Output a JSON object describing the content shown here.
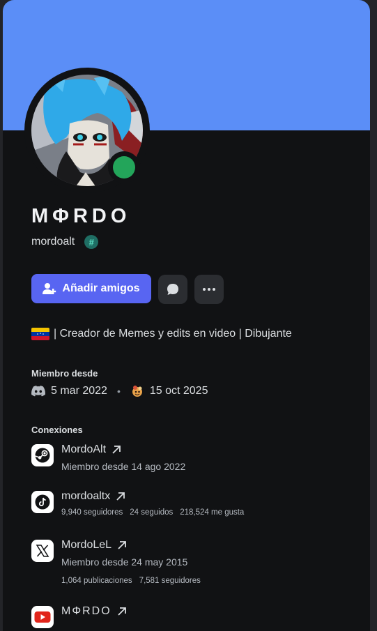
{
  "profile": {
    "display_name": "MΦRDO",
    "username": "mordoalt",
    "tag_symbol": "#",
    "online_status_color": "#23a55a",
    "banner_color": "#5b8ef7"
  },
  "actions": {
    "add_friend_label": "Añadir amigos",
    "message_icon": "chat-bubble-icon",
    "more_icon": "ellipsis-icon"
  },
  "bio": {
    "flag": "venezuela-flag",
    "text": "| Creador de Memes y edits en video | Dibujante"
  },
  "member_since": {
    "title": "Miembro desde",
    "discord_date": "5 mar 2022",
    "separator": "•",
    "server_date": "15 oct 2025"
  },
  "connections": {
    "title": "Conexiones",
    "items": [
      {
        "platform": "steam",
        "name": "MordoAlt",
        "subtitle": "Miembro desde 14 ago 2022",
        "stats": []
      },
      {
        "platform": "tiktok",
        "name": "mordoaltx",
        "subtitle": "",
        "stats": [
          "9,940 seguidores",
          "24 seguidos",
          "218,524 me gusta"
        ]
      },
      {
        "platform": "x",
        "name": "MordoLeL",
        "subtitle": "Miembro desde 24 may 2015",
        "stats": [
          "1,064 publicaciones",
          "7,581 seguidores"
        ]
      },
      {
        "platform": "youtube",
        "name": "MΦRDO",
        "subtitle": "",
        "stats": []
      }
    ]
  }
}
